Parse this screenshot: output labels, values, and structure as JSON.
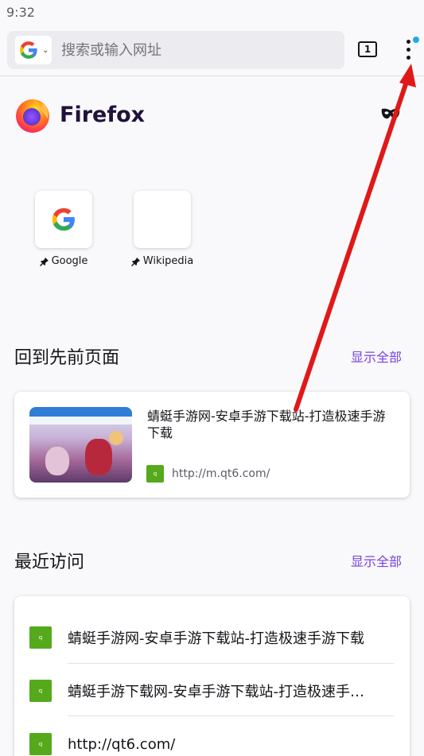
{
  "status_bar": {
    "time": "9:32"
  },
  "toolbar": {
    "search_engine_icon": "google-g-icon",
    "url_placeholder": "搜索或输入网址",
    "tab_count": "1",
    "menu_icon": "three-dot-menu-icon",
    "notification_color": "#1fa8ea"
  },
  "brand": {
    "name": "Firefox",
    "logo_icon": "firefox-logo-icon",
    "privacy_icon": "private-mask-icon"
  },
  "shortcuts": [
    {
      "label": "Google",
      "icon": "google-g-icon",
      "pinned": true
    },
    {
      "label": "Wikipedia",
      "icon": "blank-tile",
      "pinned": true
    }
  ],
  "jump_back": {
    "title": "回到先前页面",
    "show_all": "显示全部",
    "item": {
      "title": "蜻蜓手游网-安卓手游下载站-打造极速手游下载",
      "url": "http://m.qt6.com/"
    }
  },
  "recent": {
    "title": "最近访问",
    "show_all": "显示全部",
    "items": [
      {
        "title": "蜻蜓手游网-安卓手游下载站-打造极速手游下载"
      },
      {
        "title": "蜻蜓手游下载网-安卓手游下载站-打造极速手…"
      },
      {
        "title": "http://qt6.com/"
      }
    ]
  },
  "colors": {
    "accent": "#7542e5",
    "favicon_green": "#55aa1c",
    "annotation_arrow": "#e01818"
  }
}
